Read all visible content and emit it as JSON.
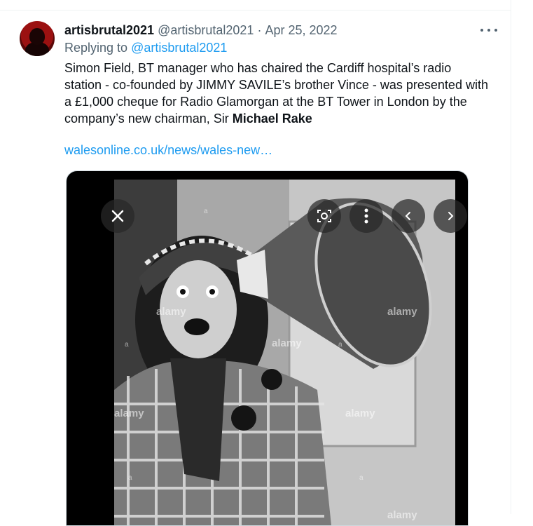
{
  "tweet": {
    "display_name": "artisbrutal2021",
    "handle": "@artisbrutal2021",
    "separator": "·",
    "date": "Apr 25, 2022",
    "replying_prefix": "Replying to",
    "replying_handle": "@artisbrutal2021",
    "text_main": "Simon Field, BT manager who has chaired the Cardiff hospital’s radio station - co-founded by JIMMY SAVILE’s brother Vince - was presented with a £1,000 cheque for Radio Glamorgan at the BT Tower in London by the company’s new chairman, Sir ",
    "text_bold": "Michael Rake",
    "link": "walesonline.co.uk/news/wales-new…"
  },
  "media": {
    "watermark": "alamy",
    "watermark_small": "a",
    "controls": {
      "close": "close-icon",
      "lens": "lens-icon",
      "more": "more-vertical-icon",
      "prev": "chevron-left-icon",
      "next": "chevron-right-icon"
    }
  },
  "colors": {
    "link": "#1d9bf0",
    "secondary": "#536471",
    "primary_text": "#0f1419"
  }
}
